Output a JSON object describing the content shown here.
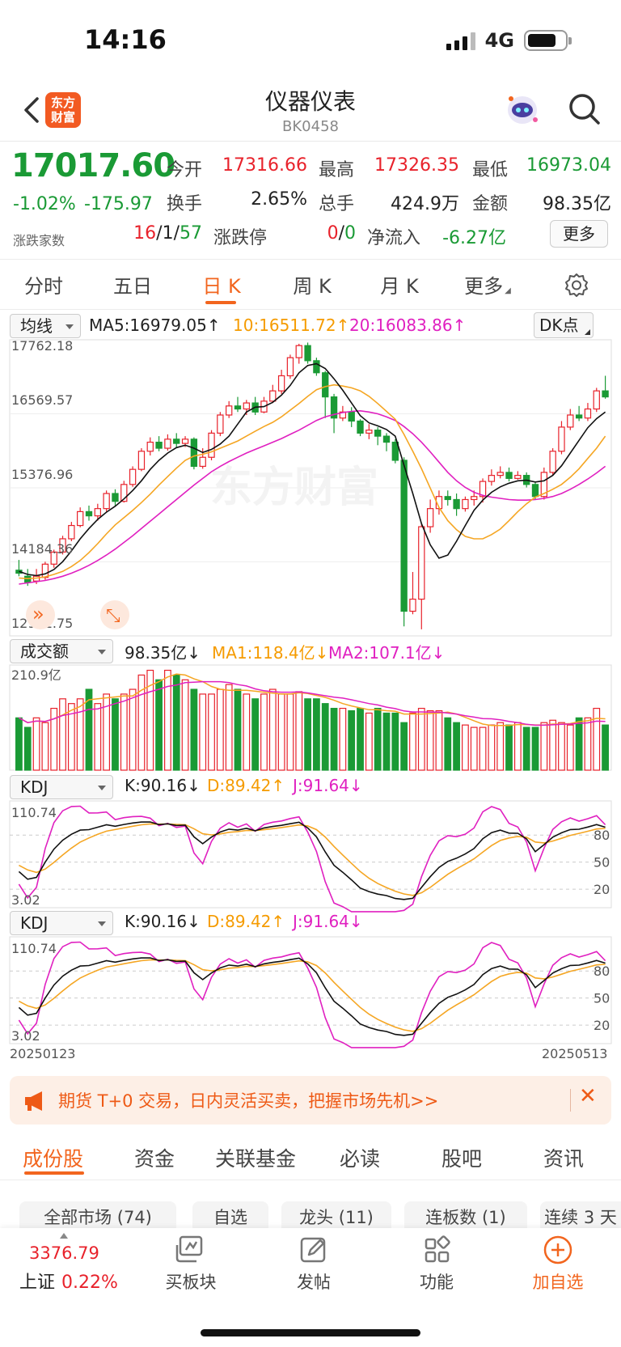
{
  "status_bar": {
    "time": "14:16",
    "network": "4G"
  },
  "header": {
    "title": "仪器仪表",
    "code": "BK0458",
    "logo_text": "东方财富"
  },
  "quote": {
    "price": "17017.60",
    "change_pct": "-1.02%",
    "change": "-175.97",
    "advance_label": "涨跌家数",
    "advance_up": "16",
    "advance_flat": "1",
    "advance_down": "57",
    "limit_label": "涨跌停",
    "limit_up": "0",
    "limit_down": "0",
    "open_label": "今开",
    "open": "17316.66",
    "high_label": "最高",
    "high": "17326.35",
    "low_label": "最低",
    "low": "16973.04",
    "turnover_label": "换手",
    "turnover": "2.65%",
    "volume_label": "总手",
    "volume": "424.9万",
    "amount_label": "金额",
    "amount": "98.35亿",
    "netflow_label": "净流入",
    "netflow": "-6.27亿",
    "more_label": "更多"
  },
  "tabs": [
    "分时",
    "五日",
    "日 K",
    "周 K",
    "月 K",
    "更多"
  ],
  "active_tab": "日 K",
  "indicators": {
    "ma_select": "均线",
    "ma5": "MA5:16979.05↑",
    "ma10": "10:16511.72↑",
    "ma20": "20:16083.86↑",
    "dk_label": "DK点",
    "vol_select": "成交额",
    "vol_value": "98.35亿↓",
    "vol_ma1": "MA1:118.4亿↓",
    "vol_ma2": "MA2:107.1亿↓",
    "kdj1_select": "KDJ",
    "kdj2_select": "KDJ",
    "kdj_k": "K:90.16↓",
    "kdj_d": "D:89.42↑",
    "kdj_j": "J:91.64↓"
  },
  "chart_labels": {
    "price_ticks": [
      "17762.18",
      "16569.57",
      "15376.96",
      "14184.36",
      "12991.75"
    ],
    "vol_max": "210.9亿",
    "kdj_max": "110.74",
    "kdj_min": "3.02",
    "kdj_levels": [
      "80",
      "50",
      "20"
    ],
    "date_start": "20250123",
    "date_end": "20250513",
    "watermark": "东方财富"
  },
  "chart_data": {
    "type": "candlestick",
    "ylim": [
      12991.75,
      17762.18
    ],
    "candles": [
      [
        14080,
        14030,
        14250,
        13980
      ],
      [
        13980,
        13880,
        14100,
        13820
      ],
      [
        13900,
        13980,
        14100,
        13850
      ],
      [
        13960,
        14180,
        14220,
        13920
      ],
      [
        14180,
        14380,
        14420,
        14120
      ],
      [
        14380,
        14600,
        14650,
        14340
      ],
      [
        14600,
        14820,
        14880,
        14560
      ],
      [
        14820,
        15050,
        15120,
        14790
      ],
      [
        15050,
        14980,
        15150,
        14900
      ],
      [
        14980,
        15100,
        15180,
        14900
      ],
      [
        15100,
        15350,
        15400,
        15050
      ],
      [
        15350,
        15220,
        15420,
        15150
      ],
      [
        15220,
        15500,
        15560,
        15200
      ],
      [
        15500,
        15750,
        15800,
        15460
      ],
      [
        15750,
        16050,
        16100,
        15720
      ],
      [
        16050,
        16200,
        16280,
        15980
      ],
      [
        16200,
        16100,
        16300,
        16050
      ],
      [
        16100,
        16250,
        16330,
        16060
      ],
      [
        16250,
        16180,
        16350,
        16100
      ],
      [
        16180,
        16250,
        16300,
        16120
      ],
      [
        16250,
        15800,
        16280,
        15750
      ],
      [
        15800,
        15950,
        16100,
        15760
      ],
      [
        15950,
        16350,
        16400,
        15900
      ],
      [
        16350,
        16650,
        16700,
        16300
      ],
      [
        16650,
        16800,
        16880,
        16600
      ],
      [
        16800,
        16750,
        16950,
        16700
      ],
      [
        16750,
        16850,
        16900,
        16650
      ],
      [
        16850,
        16700,
        16950,
        16650
      ],
      [
        16700,
        16880,
        16950,
        16680
      ],
      [
        16880,
        17050,
        17150,
        16850
      ],
      [
        17050,
        17300,
        17400,
        17000
      ],
      [
        17300,
        17600,
        17650,
        17250
      ],
      [
        17600,
        17800,
        17830,
        17500
      ],
      [
        17800,
        17550,
        17850,
        17500
      ],
      [
        17550,
        17350,
        17600,
        17300
      ],
      [
        17350,
        16950,
        17380,
        16600
      ],
      [
        16950,
        16600,
        17000,
        16350
      ],
      [
        16600,
        16700,
        16800,
        16550
      ],
      [
        16700,
        16550,
        16780,
        16450
      ],
      [
        16550,
        16350,
        16580,
        16300
      ],
      [
        16350,
        16400,
        16500,
        16250
      ],
      [
        16400,
        16300,
        16450,
        16150
      ],
      [
        16300,
        16200,
        16350,
        16050
      ],
      [
        16200,
        15900,
        16250,
        15850
      ],
      [
        15900,
        13400,
        15950,
        13150
      ],
      [
        13400,
        13600,
        14050,
        13350
      ],
      [
        13600,
        14800,
        14850,
        13100
      ],
      [
        14800,
        15100,
        15250,
        14700
      ],
      [
        15100,
        15300,
        15400,
        15000
      ],
      [
        15300,
        15250,
        15400,
        15150
      ],
      [
        15250,
        15100,
        15350,
        14980
      ],
      [
        15100,
        15250,
        15300,
        15050
      ],
      [
        15250,
        15300,
        15400,
        15150
      ],
      [
        15300,
        15550,
        15600,
        15200
      ],
      [
        15550,
        15650,
        15750,
        15480
      ],
      [
        15650,
        15700,
        15800,
        15600
      ],
      [
        15700,
        15600,
        15780,
        15550
      ],
      [
        15600,
        15650,
        15720,
        15580
      ],
      [
        15650,
        15500,
        15700,
        15450
      ],
      [
        15500,
        15300,
        15550,
        15250
      ],
      [
        15300,
        15700,
        15780,
        15250
      ],
      [
        15700,
        16050,
        16100,
        15650
      ],
      [
        16050,
        16450,
        16550,
        16000
      ],
      [
        16450,
        16650,
        16750,
        16400
      ],
      [
        16650,
        16600,
        16800,
        16550
      ],
      [
        16600,
        16750,
        16850,
        16550
      ],
      [
        16750,
        17050,
        17100,
        16700
      ],
      [
        17050,
        16950,
        17300,
        16920
      ]
    ],
    "ma5": [
      14060,
      14010,
      13990,
      14020,
      14090,
      14220,
      14400,
      14600,
      14770,
      14920,
      15040,
      15140,
      15260,
      15400,
      15560,
      15750,
      15900,
      16020,
      16110,
      16150,
      16100,
      16030,
      16080,
      16170,
      16300,
      16500,
      16700,
      16780,
      16790,
      16860,
      16980,
      17140,
      17350,
      17470,
      17500,
      17420,
      17250,
      17060,
      16850,
      16640,
      16520,
      16470,
      16410,
      16300,
      15820,
      15350,
      14850,
      14500,
      14280,
      14330,
      14560,
      14820,
      15070,
      15240,
      15370,
      15460,
      15520,
      15560,
      15570,
      15540,
      15560,
      15650,
      15810,
      16020,
      16230,
      16440,
      16590,
      16700
    ],
    "ma10": [
      13950,
      13940,
      13950,
      13970,
      14010,
      14060,
      14140,
      14240,
      14370,
      14520,
      14680,
      14830,
      14950,
      15070,
      15200,
      15340,
      15490,
      15630,
      15770,
      15900,
      15970,
      16000,
      16040,
      16100,
      16160,
      16220,
      16300,
      16380,
      16460,
      16530,
      16620,
      16730,
      16840,
      16960,
      17070,
      17120,
      17150,
      17130,
      17100,
      17050,
      16960,
      16840,
      16710,
      16580,
      16330,
      16050,
      15760,
      15440,
      15120,
      14900,
      14750,
      14640,
      14600,
      14600,
      14670,
      14760,
      14900,
      15050,
      15180,
      15290,
      15350,
      15420,
      15500,
      15620,
      15760,
      15930,
      16100,
      16300
    ],
    "ma20": [
      13850,
      13870,
      13890,
      13910,
      13940,
      13980,
      14030,
      14090,
      14160,
      14240,
      14330,
      14430,
      14540,
      14650,
      14770,
      14890,
      15010,
      15130,
      15250,
      15370,
      15490,
      15600,
      15710,
      15800,
      15880,
      15950,
      16020,
      16080,
      16140,
      16200,
      16260,
      16330,
      16400,
      16480,
      16560,
      16620,
      16660,
      16690,
      16710,
      16720,
      16700,
      16670,
      16620,
      16560,
      16460,
      16340,
      16200,
      16040,
      15870,
      15700,
      15560,
      15450,
      15370,
      15320,
      15290,
      15270,
      15250,
      15240,
      15240,
      15250,
      15270,
      15300,
      15350,
      15420,
      15500,
      15590,
      15690,
      15800
    ],
    "volume": [
      110,
      90,
      110,
      100,
      130,
      150,
      140,
      150,
      170,
      140,
      160,
      150,
      160,
      170,
      200,
      210,
      190,
      210,
      200,
      190,
      170,
      160,
      160,
      170,
      180,
      170,
      160,
      150,
      160,
      170,
      160,
      160,
      165,
      150,
      150,
      140,
      130,
      130,
      125,
      130,
      120,
      130,
      120,
      120,
      100,
      120,
      130,
      125,
      125,
      110,
      100,
      95,
      90,
      90,
      95,
      100,
      95,
      100,
      90,
      90,
      100,
      105,
      100,
      95,
      110,
      110,
      130,
      95
    ],
    "volume_max": 210.9
  },
  "banner": {
    "text": "期货 T+0 交易，日内灵活买卖，把握市场先机>>"
  },
  "bottom_tabs": [
    "成份股",
    "资金",
    "关联基金",
    "必读",
    "股吧",
    "资讯"
  ],
  "filter_chips": [
    "全部市场 (74)",
    "自选",
    "龙头 (11)",
    "连板数 (1)",
    "连续 3 天"
  ],
  "nav": {
    "index_value": "3376.79",
    "index_name": "上证",
    "index_pct": "0.22%",
    "items": [
      "买板块",
      "发帖",
      "功能",
      "加自选"
    ]
  }
}
